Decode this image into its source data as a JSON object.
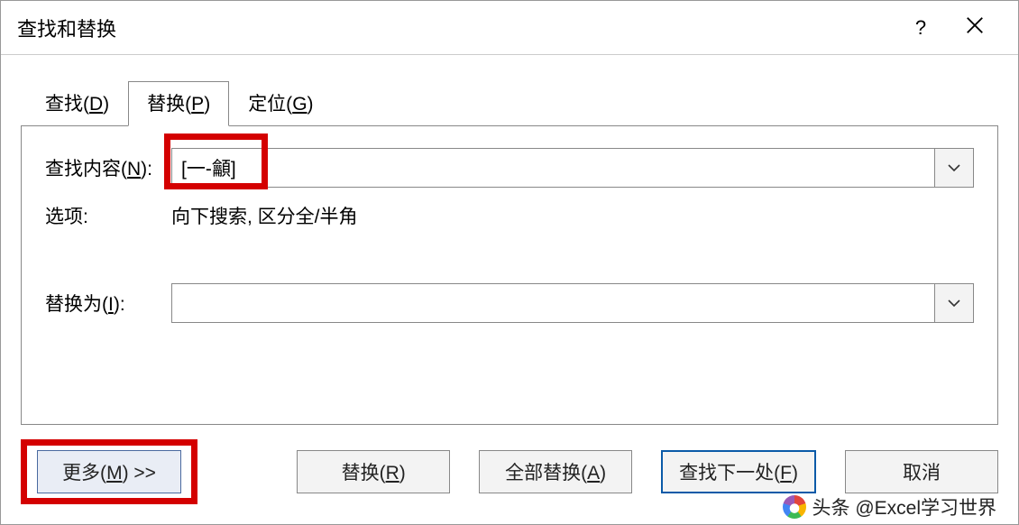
{
  "title": "查找和替换",
  "help": "?",
  "tabs": {
    "find": "查找(D)",
    "replace": "替换(P)",
    "goto": "定位(G)"
  },
  "labels": {
    "find_what": "查找内容(N):",
    "options": "选项:",
    "replace_with": "替换为(I):"
  },
  "values": {
    "find_what": "[一-龥]",
    "options": "向下搜索, 区分全/半角",
    "replace_with": ""
  },
  "buttons": {
    "more": "更多(M) >>",
    "replace": "替换(R)",
    "replace_all": "全部替换(A)",
    "find_next": "查找下一处(F)",
    "cancel": "取消"
  },
  "watermark": "头条 @Excel学习世界"
}
